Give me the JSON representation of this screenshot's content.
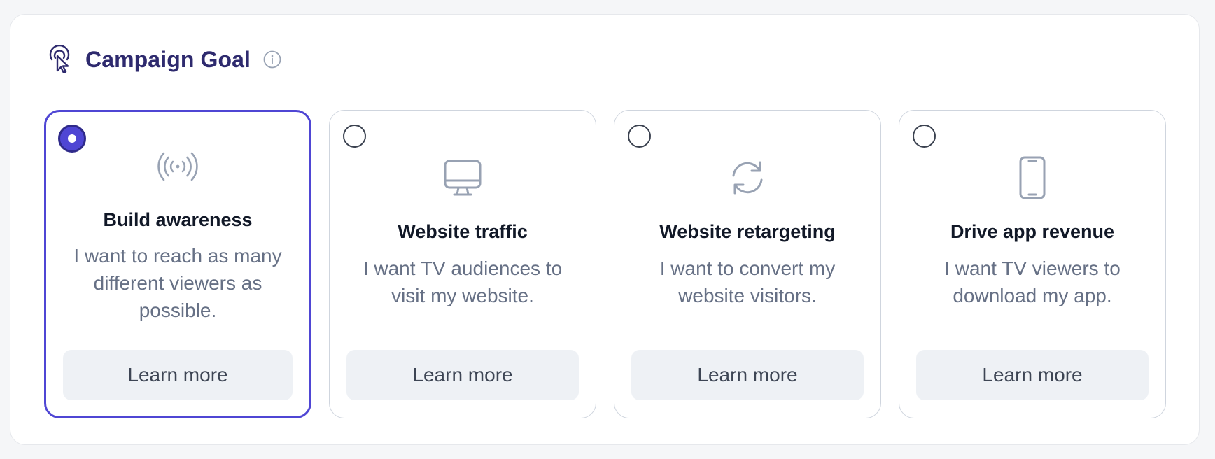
{
  "section": {
    "title": "Campaign Goal",
    "icon": "cursor-click-icon",
    "info_icon": "info-icon"
  },
  "accent_color": "#4f46d4",
  "title_color": "#2e2a6e",
  "options": [
    {
      "title": "Build awareness",
      "description": "I want to reach as many different viewers as possible.",
      "button": "Learn more",
      "icon": "broadcast-icon",
      "selected": true
    },
    {
      "title": "Website traffic",
      "description": "I want TV audiences to visit my website.",
      "button": "Learn more",
      "icon": "monitor-icon",
      "selected": false
    },
    {
      "title": "Website retargeting",
      "description": "I want to convert my website visitors.",
      "button": "Learn more",
      "icon": "refresh-icon",
      "selected": false
    },
    {
      "title": "Drive app revenue",
      "description": "I want TV viewers to download my app.",
      "button": "Learn more",
      "icon": "smartphone-icon",
      "selected": false
    }
  ]
}
